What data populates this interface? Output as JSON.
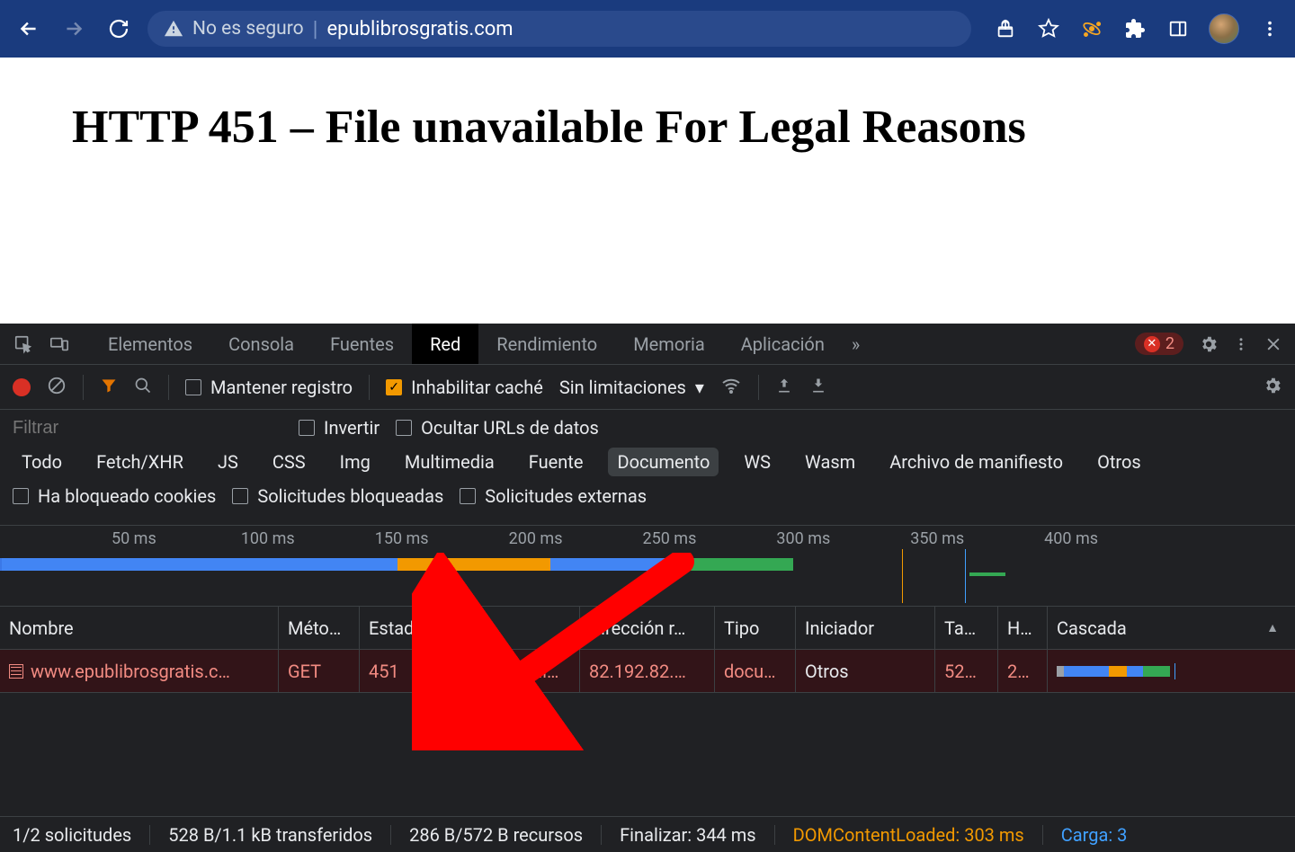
{
  "browser": {
    "insecure_label": "No es seguro",
    "url": "epublibrosgratis.com"
  },
  "page": {
    "h1": "HTTP 451 – File unavailable For Legal Reasons"
  },
  "devtools": {
    "tabs": [
      "Elementos",
      "Consola",
      "Fuentes",
      "Red",
      "Rendimiento",
      "Memoria",
      "Aplicación"
    ],
    "tabs_active_index": 3,
    "more": "»",
    "error_count": "2",
    "toolbar": {
      "preserve_log": "Mantener registro",
      "disable_cache": "Inhabilitar caché",
      "throttle": "Sin limitaciones"
    },
    "filter": {
      "placeholder": "Filtrar",
      "invert": "Invertir",
      "hide_data": "Ocultar URLs de datos",
      "types": [
        "Todo",
        "Fetch/XHR",
        "JS",
        "CSS",
        "Img",
        "Multimedia",
        "Fuente",
        "Documento",
        "WS",
        "Wasm",
        "Archivo de manifiesto",
        "Otros"
      ],
      "types_selected_index": 7,
      "blocked_cookies": "Ha bloqueado cookies",
      "blocked_requests": "Solicitudes bloqueadas",
      "third_party": "Solicitudes externas"
    },
    "timeline": {
      "ticks": [
        "50 ms",
        "100 ms",
        "150 ms",
        "200 ms",
        "250 ms",
        "300 ms",
        "350 ms",
        "400 ms"
      ]
    },
    "columns": [
      "Nombre",
      "Méto…",
      "Estado",
      "",
      "Dirección r…",
      "Tipo",
      "Iniciador",
      "Ta…",
      "H…",
      "Cascada"
    ],
    "columns_sort_indicator": "▲",
    "row": {
      "name": "www.epublibrosgratis.c…",
      "method": "GET",
      "status": "451",
      "domain": "www.epubli…",
      "ip": "82.192.82.…",
      "type": "docu…",
      "initiator": "Otros",
      "size": "52…",
      "time": "2…"
    },
    "statusbar": {
      "requests": "1/2 solicitudes",
      "transferred": "528 B/1.1 kB transferidos",
      "resources": "286 B/572 B recursos",
      "finish": "Finalizar: 344 ms",
      "dcl": "DOMContentLoaded: 303 ms",
      "load": "Carga: 3"
    }
  }
}
